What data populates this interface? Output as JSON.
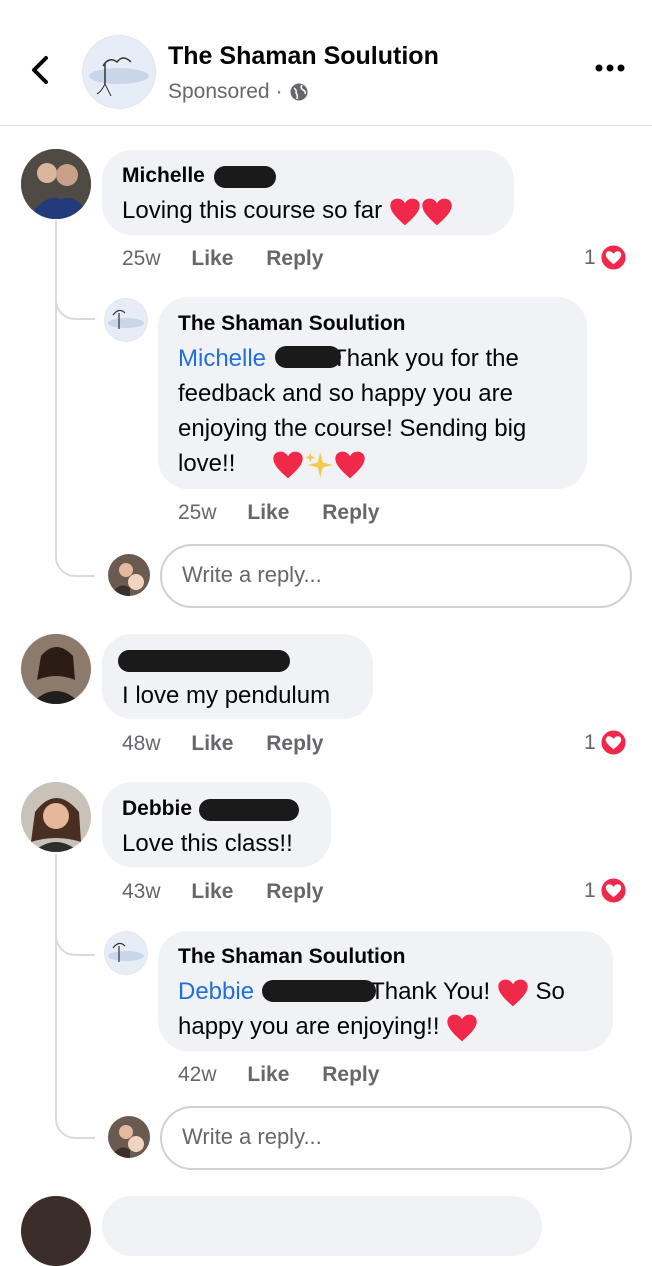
{
  "header": {
    "page_name": "The Shaman Soulution",
    "sponsored": "Sponsored",
    "dot": "·",
    "back_icon": "chevron-left-icon",
    "more_icon": "more-horizontal-icon",
    "globe_icon": "globe-icon"
  },
  "comments": [
    {
      "author": "Michelle",
      "text": "Loving this course so far",
      "time": "25w",
      "like": "Like",
      "reply": "Reply",
      "reactions": "1",
      "replies": [
        {
          "author": "The Shaman Soulution",
          "mention": "Michelle",
          "line1": "Thank you for the",
          "line2": "feedback and so happy you are",
          "line3": "enjoying the course! Sending big",
          "line4": "love!!",
          "time": "25w",
          "like": "Like",
          "reply": "Reply"
        }
      ]
    },
    {
      "author": "",
      "text": "I love my pendulum",
      "time": "48w",
      "like": "Like",
      "reply": "Reply",
      "reactions": "1"
    },
    {
      "author": "Debbie",
      "text": "Love this class!!",
      "time": "43w",
      "like": "Like",
      "reply": "Reply",
      "reactions": "1",
      "replies": [
        {
          "author": "The Shaman Soulution",
          "mention": "Debbie",
          "line1a": "Thank You!",
          "line1b": "So",
          "line2": "happy you are enjoying!!",
          "time": "42w",
          "like": "Like",
          "reply": "Reply"
        }
      ]
    }
  ],
  "reply_box": {
    "placeholder": "Write a reply..."
  },
  "colors": {
    "accent": "#216fdb",
    "heart": "#f0284a",
    "bubble": "#f0f2f5",
    "muted": "#65676b"
  }
}
